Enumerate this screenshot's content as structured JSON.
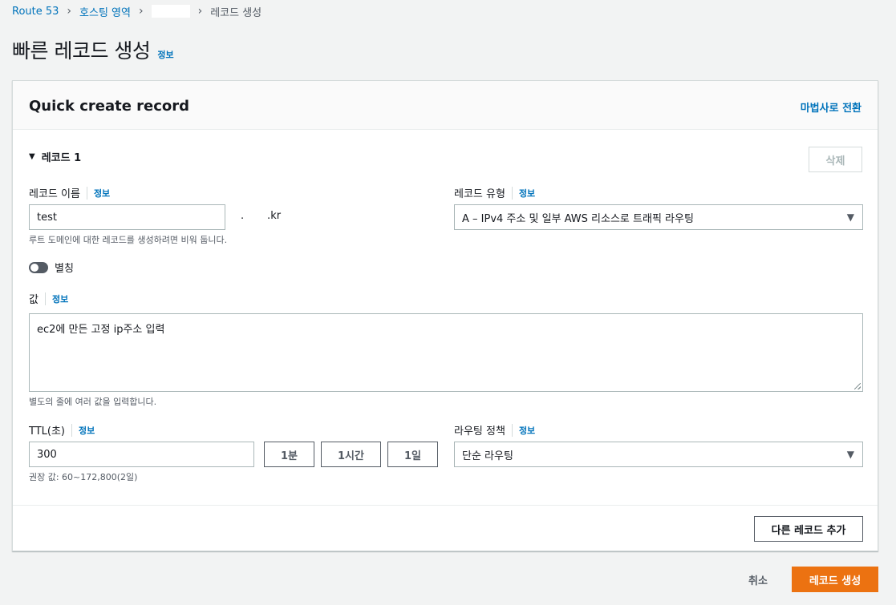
{
  "breadcrumb": {
    "items": [
      "Route 53",
      "호스팅 영역",
      "레코드 생성"
    ]
  },
  "page": {
    "title": "빠른 레코드 생성",
    "info": "정보"
  },
  "container": {
    "title": "Quick create record",
    "wizard_link": "마법사로 전환"
  },
  "record": {
    "section_title": "레코드 1",
    "delete_label": "삭제",
    "name_label": "레코드 이름",
    "name_info": "정보",
    "name_value": "test",
    "domain_suffix": ".       .kr",
    "name_hint": "루트 도메인에 대한 레코드를 생성하려면 비워 둡니다.",
    "type_label": "레코드 유형",
    "type_info": "정보",
    "type_value": "A – IPv4 주소 및 일부 AWS 리소스로 트래픽 라우팅",
    "alias_label": "별칭",
    "value_label": "값",
    "value_info": "정보",
    "value_text": "ec2에 만든 고정 ip주소 입력",
    "value_hint": "별도의 줄에 여러 값을 입력합니다.",
    "ttl_label": "TTL(초)",
    "ttl_info": "정보",
    "ttl_value": "300",
    "ttl_buttons": [
      "1분",
      "1시간",
      "1일"
    ],
    "ttl_hint": "권장 값: 60~172,800(2일)",
    "routing_label": "라우팅 정책",
    "routing_info": "정보",
    "routing_value": "단순 라우팅"
  },
  "footer": {
    "add_record": "다른 레코드 추가",
    "cancel": "취소",
    "create": "레코드 생성"
  },
  "colors": {
    "link": "#0073bb",
    "primary": "#ec7211",
    "background": "#f2f3f3"
  },
  "icons": [
    "chevron-right-icon",
    "caret-down-icon",
    "dropdown-arrow-icon",
    "resize-grip-icon"
  ]
}
